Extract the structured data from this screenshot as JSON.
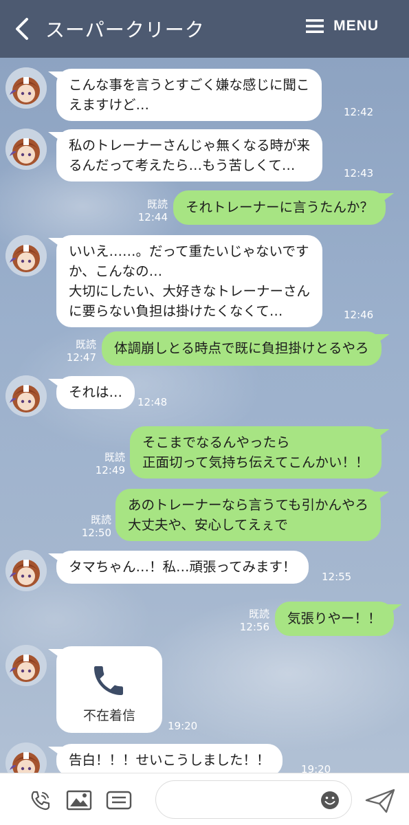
{
  "header": {
    "title": "スーパークリーク",
    "menu_label": "MENU"
  },
  "messages": [
    {
      "lines": [
        "こんな事を言うとすごく嫌な感じに聞こ",
        "えますけど…"
      ],
      "time": "12:42"
    },
    {
      "lines": [
        "私のトレーナーさんじゃ無くなる時が来",
        "るんだって考えたら…もう苦しくて…"
      ],
      "time": "12:43"
    },
    {
      "lines": [
        "それトレーナーに言うたんか？"
      ],
      "read": "既読",
      "time": "12:44"
    },
    {
      "lines": [
        "いいえ……。だって重たいじゃないです",
        "か、こんなの…",
        "大切にしたい、大好きなトレーナーさん",
        "に要らない負担は掛けたくなくて…"
      ],
      "time": "12:46"
    },
    {
      "lines": [
        "体調崩しとる時点で既に負担掛けとるやろ"
      ],
      "read": "既読",
      "time": "12:47"
    },
    {
      "lines": [
        "それは…"
      ],
      "time": "12:48"
    },
    {
      "lines": [
        "そこまでなるんやったら",
        "正面切って気持ち伝えてこんかい！！"
      ],
      "read": "既読",
      "time": "12:49"
    },
    {
      "lines": [
        "あのトレーナーなら言うても引かんやろ",
        "大丈夫や、安心してえぇで"
      ],
      "read": "既読",
      "time": "12:50"
    },
    {
      "lines": [
        "タマちゃん…！私…頑張ってみます！"
      ],
      "time": "12:55"
    },
    {
      "lines": [
        "気張りやー！！"
      ],
      "read": "既読",
      "time": "12:56"
    },
    {
      "call_label": "不在着信",
      "time": "19:20"
    },
    {
      "lines": [
        "告白！！！せいこうしました！！"
      ],
      "time": "19:20"
    }
  ],
  "footer": {
    "input_placeholder": ""
  },
  "colors": {
    "header_bg": "#4d5a71",
    "incoming_bubble": "#ffffff",
    "outgoing_bubble": "#a7e483",
    "footer_bg": "#ffffff"
  },
  "icons": [
    "back-arrow-icon",
    "menu-icon",
    "voice-call-icon",
    "image-icon",
    "keep-memo-icon",
    "emoji-icon",
    "send-icon",
    "phone-icon"
  ]
}
